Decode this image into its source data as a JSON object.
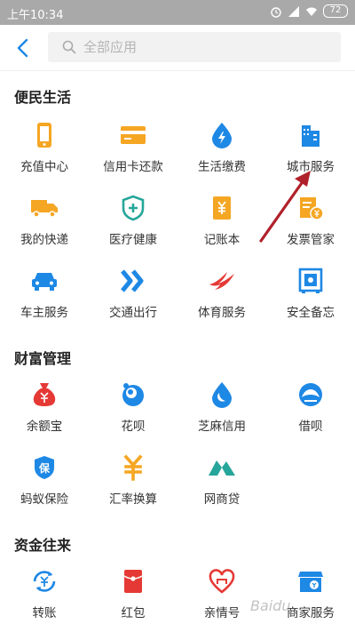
{
  "status_bar": {
    "time": "上午10:34",
    "battery": "72"
  },
  "search": {
    "placeholder": "全部应用"
  },
  "sections": [
    {
      "title": "便民生活",
      "items": [
        {
          "label": "充值中心",
          "icon": "phone-icon",
          "color": "#f5a623"
        },
        {
          "label": "信用卡还款",
          "icon": "credit-card-icon",
          "color": "#f5a623"
        },
        {
          "label": "生活缴费",
          "icon": "water-drop-icon",
          "color": "#1e88e5"
        },
        {
          "label": "城市服务",
          "icon": "city-building-icon",
          "color": "#1e88e5"
        },
        {
          "label": "我的快递",
          "icon": "truck-icon",
          "color": "#f5a623"
        },
        {
          "label": "医疗健康",
          "icon": "medical-shield-icon",
          "color": "#26a69a"
        },
        {
          "label": "记账本",
          "icon": "ledger-icon",
          "color": "#f5a623"
        },
        {
          "label": "发票管家",
          "icon": "invoice-icon",
          "color": "#f5a623"
        },
        {
          "label": "车主服务",
          "icon": "car-icon",
          "color": "#1e88e5"
        },
        {
          "label": "交通出行",
          "icon": "transport-arrows-icon",
          "color": "#1e88e5"
        },
        {
          "label": "体育服务",
          "icon": "sports-swoosh-icon",
          "color": "#e53935"
        },
        {
          "label": "安全备忘",
          "icon": "safe-box-icon",
          "color": "#1e88e5"
        }
      ]
    },
    {
      "title": "财富管理",
      "items": [
        {
          "label": "余额宝",
          "icon": "money-bag-icon",
          "color": "#e53935"
        },
        {
          "label": "花呗",
          "icon": "huabei-icon",
          "color": "#1e88e5"
        },
        {
          "label": "芝麻信用",
          "icon": "sesame-drop-icon",
          "color": "#1e88e5"
        },
        {
          "label": "借呗",
          "icon": "jiebei-shell-icon",
          "color": "#1e88e5"
        },
        {
          "label": "蚂蚁保险",
          "icon": "insurance-shield-icon",
          "color": "#1e88e5"
        },
        {
          "label": "汇率换算",
          "icon": "exchange-rate-icon",
          "color": "#f5a623"
        },
        {
          "label": "网商贷",
          "icon": "mybank-mountain-icon",
          "color": "#26a69a"
        }
      ]
    },
    {
      "title": "资金往来",
      "items": [
        {
          "label": "转账",
          "icon": "transfer-icon",
          "color": "#1e88e5"
        },
        {
          "label": "红包",
          "icon": "red-envelope-icon",
          "color": "#e53935"
        },
        {
          "label": "亲情号",
          "icon": "family-heart-icon",
          "color": "#e53935"
        },
        {
          "label": "商家服务",
          "icon": "merchant-store-icon",
          "color": "#1e88e5"
        }
      ]
    }
  ],
  "watermark": "Baidu"
}
